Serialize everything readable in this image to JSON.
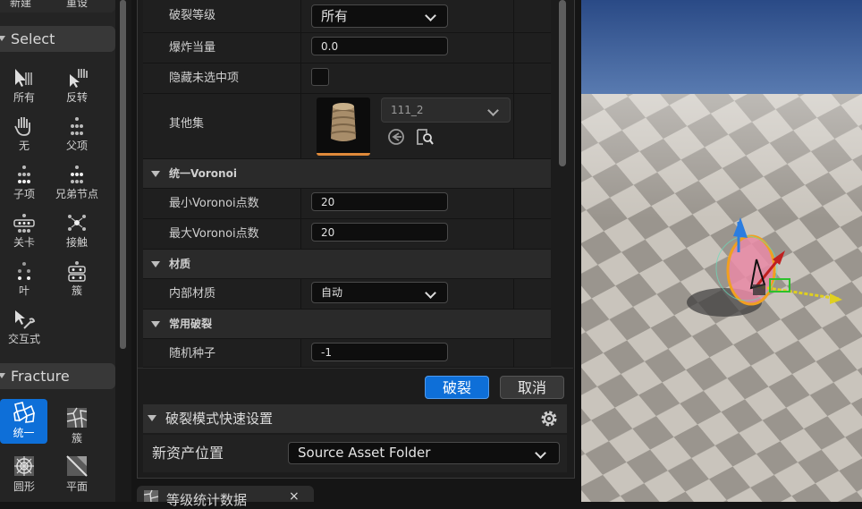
{
  "toolbar_top": {
    "new_label": "新建",
    "reset_label": "重设"
  },
  "select_section": {
    "title": "Select",
    "tools": [
      {
        "label": "所有",
        "icon": "select-all-icon"
      },
      {
        "label": "反转",
        "icon": "select-invert-icon"
      },
      {
        "label": "无",
        "icon": "select-none-icon"
      },
      {
        "label": "父项",
        "icon": "select-parent-icon"
      },
      {
        "label": "子项",
        "icon": "select-children-icon"
      },
      {
        "label": "兄弟节点",
        "icon": "select-siblings-icon"
      },
      {
        "label": "关卡",
        "icon": "select-level-icon"
      },
      {
        "label": "接触",
        "icon": "select-contact-icon"
      },
      {
        "label": "叶",
        "icon": "select-leaf-icon"
      },
      {
        "label": "簇",
        "icon": "select-cluster-icon"
      },
      {
        "label": "交互式",
        "icon": "select-interactive-icon"
      }
    ]
  },
  "fracture_section": {
    "title": "Fracture",
    "tools": [
      {
        "label": "统一",
        "icon": "uniform-fracture-icon",
        "active": true
      },
      {
        "label": "簇",
        "icon": "cluster-fracture-icon"
      },
      {
        "label": "圆形",
        "icon": "radial-fracture-icon"
      },
      {
        "label": "平面",
        "icon": "planar-fracture-icon"
      }
    ]
  },
  "details": {
    "fracture_level_label": "破裂等级",
    "fracture_level_value": "所有",
    "explosion_amount_label": "爆炸当量",
    "explosion_amount_value": "0.0",
    "hide_unselected_label": "隐藏未选中项",
    "other_set_label": "其他集",
    "other_set_value": "111_2",
    "uniform_voronoi_title": "统一Voronoi",
    "min_voronoi_label": "最小Voronoi点数",
    "min_voronoi_value": "20",
    "max_voronoi_label": "最大Voronoi点数",
    "max_voronoi_value": "20",
    "material_title": "材质",
    "internal_material_label": "内部材质",
    "internal_material_value": "自动",
    "common_fracture_title": "常用破裂",
    "random_seed_label": "随机种子",
    "random_seed_value": "-1"
  },
  "actions": {
    "fracture_label": "破裂",
    "cancel_label": "取消"
  },
  "quick_settings": {
    "title": "破裂模式快速设置",
    "new_asset_location_label": "新资产位置",
    "new_asset_location_value": "Source Asset Folder"
  },
  "bottom_tab": {
    "label": "等级统计数据"
  },
  "colors": {
    "accent": "#0e6fd8",
    "panel": "#1f1f1f",
    "header": "#383838"
  }
}
